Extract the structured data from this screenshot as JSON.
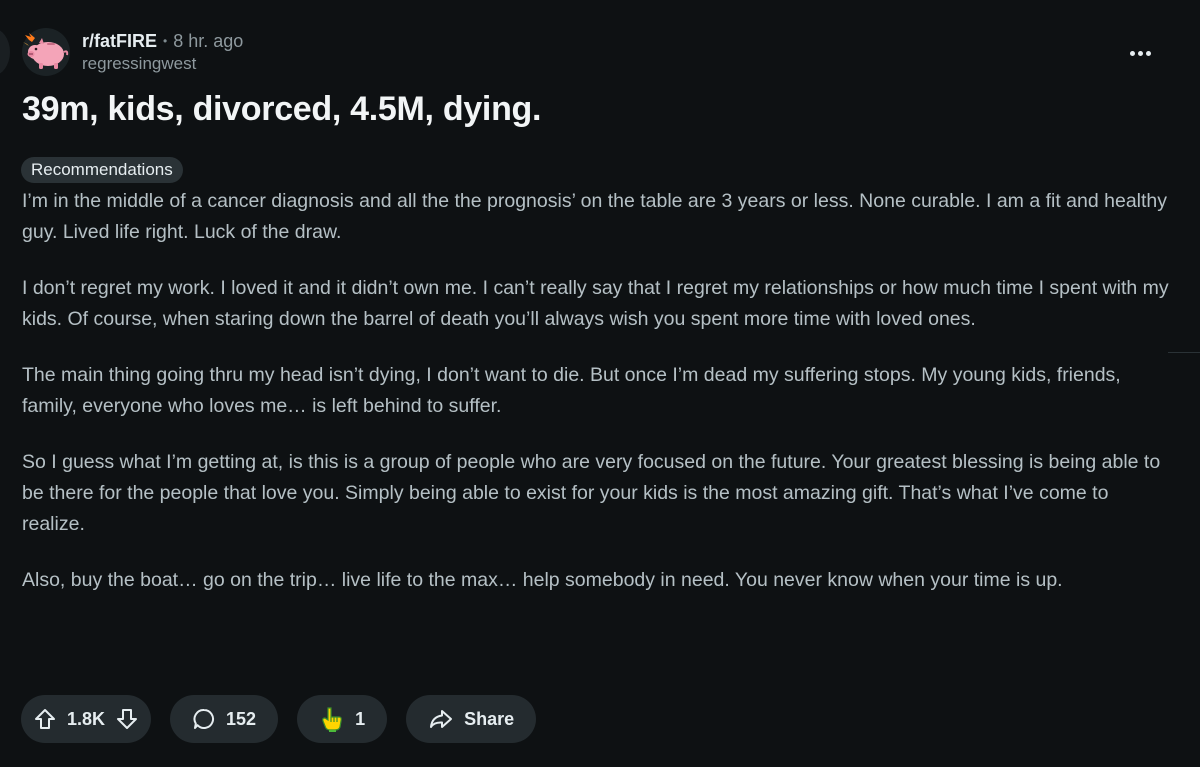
{
  "post": {
    "subreddit": "r/fatFIRE",
    "separator": "•",
    "time": "8 hr. ago",
    "author": "regressingwest",
    "title": "39m, kids, divorced, 4.5M, dying.",
    "flair": "Recommendations",
    "paragraphs": [
      "I’m in the middle of a cancer diagnosis and all the the prognosis’ on the table are 3 years or less. None curable. I am a fit and healthy guy. Lived life right. Luck of the draw.",
      "I don’t regret my work. I loved it and it didn’t own me. I can’t really say that I regret my relationships or how much time I spent with my kids. Of course, when staring down the barrel of death you’ll always wish you spent more time with loved ones.",
      "The main thing going thru my head isn’t dying, I don’t want to die. But once I’m dead my suffering stops. My young kids, friends, family, everyone who loves me… is left behind to suffer.",
      "So I guess what I’m getting at, is this is a group of people who are very focused on the future. Your greatest blessing is being able to be there for the people that love you. Simply being able to exist for your kids is the most amazing gift. That’s what I’ve come to realize.",
      "Also, buy the boat… go on the trip… live life to the max… help somebody in need. You never know when your time is up."
    ]
  },
  "actions": {
    "score": "1.8K",
    "comments": "152",
    "awards": "1",
    "share_label": "Share"
  },
  "icons": {
    "avatar": "subreddit-piggy-bank-icon",
    "more": "more-options-icon",
    "upvote": "upvote-arrow-icon",
    "downvote": "downvote-arrow-icon",
    "comment": "comment-bubble-icon",
    "award": "award-hand-icon",
    "share": "share-arrow-icon"
  },
  "colors": {
    "background": "#0e1113",
    "pill": "#242b2f",
    "title": "#f2f5f6",
    "body_text": "#b5c0c5",
    "muted": "#8e999e"
  }
}
